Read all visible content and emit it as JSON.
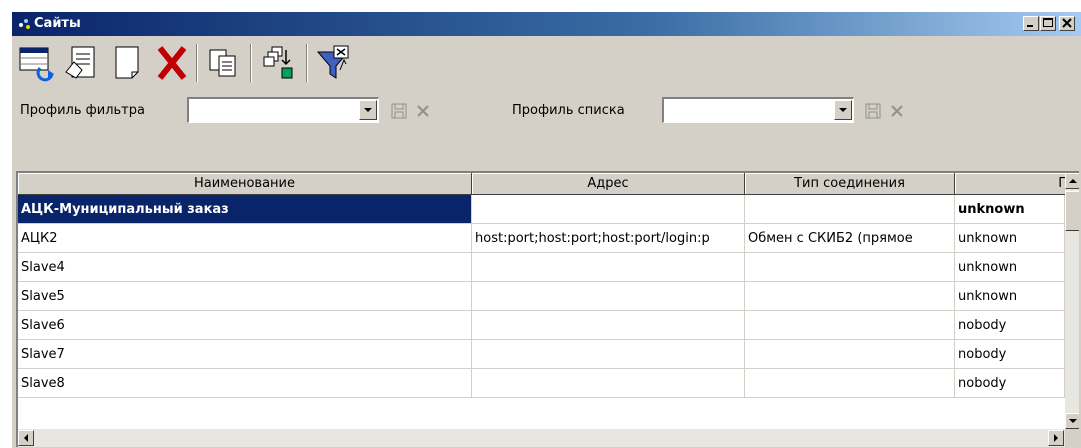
{
  "window": {
    "title": "Сайты"
  },
  "toolbar": {
    "buttons": [
      {
        "icon": "refresh-icon"
      },
      {
        "icon": "edit-document-icon"
      },
      {
        "icon": "new-document-icon"
      },
      {
        "icon": "delete-icon"
      },
      {
        "icon": "copy-icon"
      },
      {
        "icon": "export-icon"
      },
      {
        "icon": "filter-icon"
      }
    ]
  },
  "filters": {
    "filter_profile_label": "Профиль фильтра",
    "filter_profile_value": "",
    "list_profile_label": "Профиль списка",
    "list_profile_value": ""
  },
  "table": {
    "columns": [
      "Наименование",
      "Адрес",
      "Тип соединения",
      "П"
    ],
    "rows": [
      {
        "name": "АЦК-Муниципальный заказ",
        "address": "",
        "conn": "",
        "p": "unknown",
        "selected": true
      },
      {
        "name": "АЦК2",
        "address": "host:port;host:port;host:port/login:p",
        "conn": "Обмен с СКИБ2 (прямое",
        "p": "unknown"
      },
      {
        "name": "Slave4",
        "address": "",
        "conn": "",
        "p": "unknown"
      },
      {
        "name": "Slave5",
        "address": "",
        "conn": "",
        "p": "unknown"
      },
      {
        "name": "Slave6",
        "address": "",
        "conn": "",
        "p": "nobody"
      },
      {
        "name": "Slave7",
        "address": "",
        "conn": "",
        "p": "nobody"
      },
      {
        "name": "Slave8",
        "address": "",
        "conn": "",
        "p": "nobody"
      }
    ]
  }
}
